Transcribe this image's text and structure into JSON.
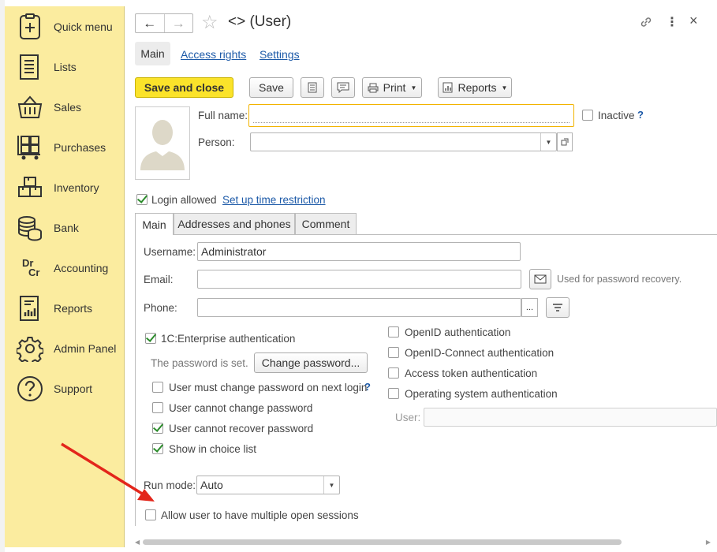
{
  "sidebar": {
    "items": [
      {
        "label": "Quick menu",
        "icon": "quick-menu-icon"
      },
      {
        "label": "Lists",
        "icon": "lists-icon"
      },
      {
        "label": "Sales",
        "icon": "basket-icon"
      },
      {
        "label": "Purchases",
        "icon": "cart-icon"
      },
      {
        "label": "Inventory",
        "icon": "boxes-icon"
      },
      {
        "label": "Bank",
        "icon": "coins-icon"
      },
      {
        "label": "Accounting",
        "icon": "dr-cr-icon"
      },
      {
        "label": "Reports",
        "icon": "report-chart-icon"
      },
      {
        "label": "Admin Panel",
        "icon": "gear-icon"
      },
      {
        "label": "Support",
        "icon": "question-icon"
      }
    ],
    "dr": "Dr",
    "cr": "Cr"
  },
  "window": {
    "title": "<> (User)",
    "nav": {
      "back": "←",
      "forward": "→",
      "star": "☆",
      "link": "⛓",
      "more": "⋮",
      "close": "×"
    },
    "top_tabs": [
      "Main",
      "Access rights",
      "Settings"
    ],
    "toolbar": {
      "save_close": "Save and close",
      "save": "Save",
      "print": "Print",
      "reports": "Reports"
    },
    "form": {
      "full_name_label": "Full name:",
      "full_name_value": "",
      "inactive_label": "Inactive",
      "help": "?",
      "person_label": "Person:",
      "person_value": "",
      "login_allowed": "Login allowed",
      "time_restriction": "Set up time restriction"
    },
    "inner_tabs": [
      "Main",
      "Addresses and phones",
      "Comment"
    ],
    "main_tab": {
      "username_label": "Username:",
      "username_value": "Administrator",
      "email_label": "Email:",
      "email_value": "",
      "email_note": "Used for password recovery.",
      "phone_label": "Phone:",
      "phone_value": "",
      "ellipsis": "...",
      "auth_1c": "1C:Enterprise authentication",
      "password_set": "The password is set.",
      "change_password": "Change password...",
      "must_change": "User must change password on next login",
      "cannot_change": "User cannot change password",
      "cannot_recover": "User cannot recover password",
      "show_in_list": "Show in choice list",
      "openid": "OpenID authentication",
      "openid_connect": "OpenID-Connect authentication",
      "access_token": "Access token authentication",
      "os_auth": "Operating system authentication",
      "os_user_label": "User:",
      "os_user_value": "",
      "run_mode_label": "Run mode:",
      "run_mode_value": "Auto",
      "multiple_sessions": "Allow user to have multiple open sessions"
    },
    "checkbox_states": {
      "inactive": false,
      "login_allowed": true,
      "auth_1c": true,
      "must_change": false,
      "cannot_change": false,
      "cannot_recover": true,
      "show_in_list": true,
      "openid": false,
      "openid_connect": false,
      "access_token": false,
      "os_auth": false,
      "multiple_sessions": false
    }
  },
  "colors": {
    "sidebar": "#fbec9f",
    "accent_yellow": "#fbe32a",
    "link": "#1d5aa8",
    "check": "#2c8c2c",
    "arrow": "#e3261b"
  }
}
